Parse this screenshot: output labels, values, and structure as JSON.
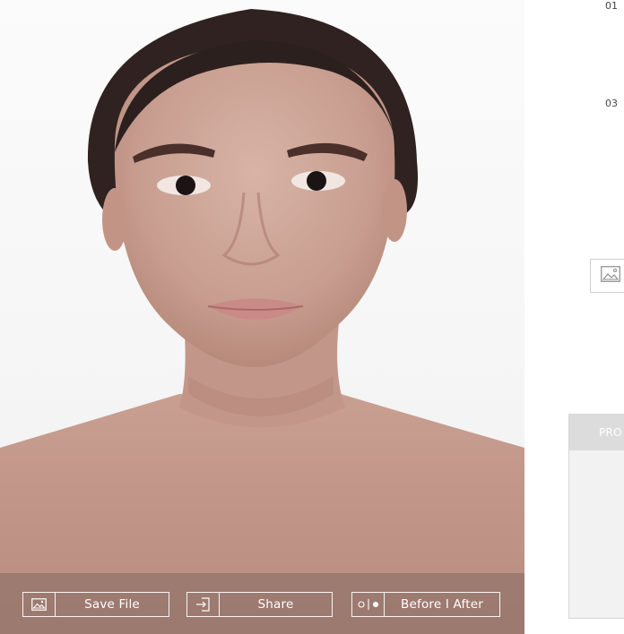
{
  "photo": {
    "alt_subject": "portrait-photo"
  },
  "actions": {
    "save_label": "Save File",
    "share_label": "Share",
    "before_after_label": "Before I After"
  },
  "steps": {
    "step1": "01",
    "step3": "03"
  },
  "panel": {
    "header": "PRO"
  },
  "icons": {
    "save": "image-icon",
    "share": "share-icon",
    "before_after": "before-after-icon",
    "thumb": "image-icon"
  },
  "colors": {
    "bar_overlay": "#96766c",
    "panel_header": "#dcdcdc",
    "panel_body": "#f2f2f2"
  }
}
